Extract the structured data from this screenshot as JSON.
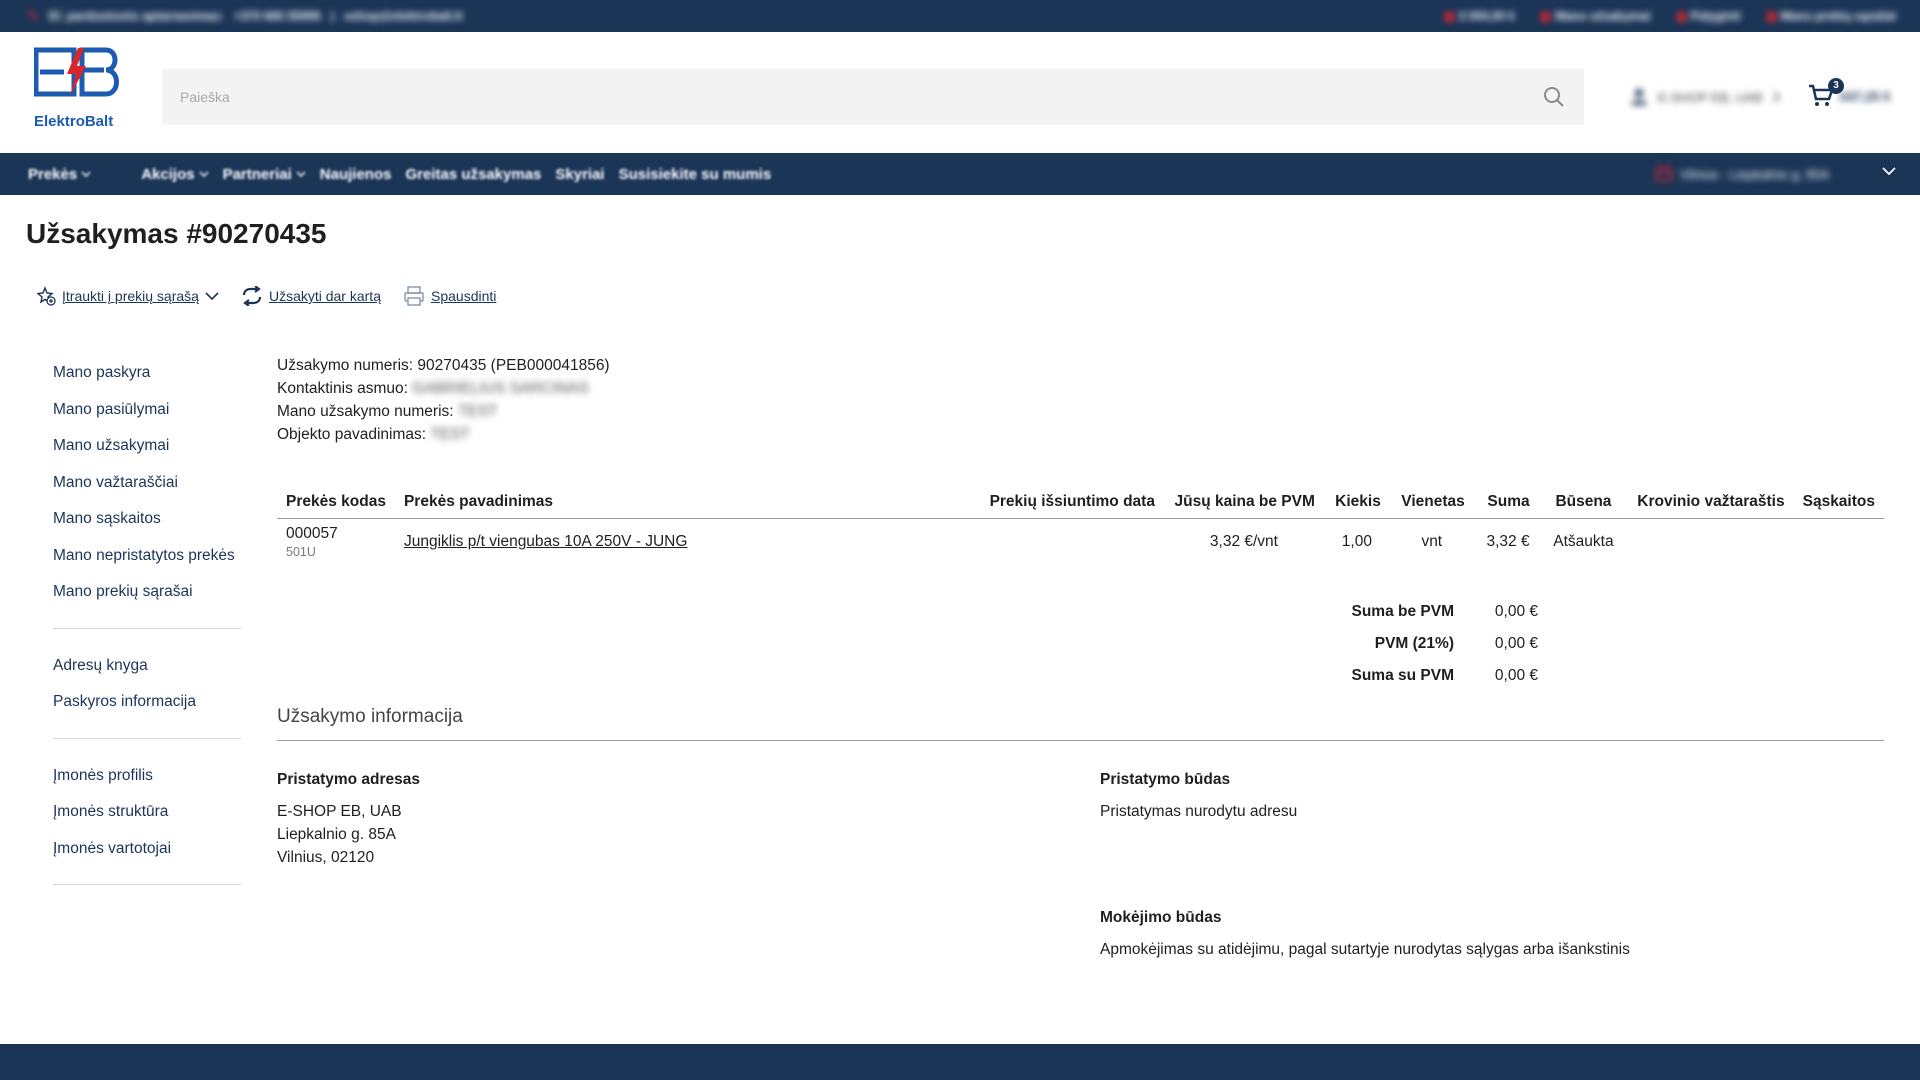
{
  "topbar": {
    "left_label": "El. parduotuvės aptarnavimas:",
    "phone": "+370 665 55995",
    "divider": "|",
    "email": "eshop@elektrobalt.lt",
    "right_items": [
      "3 000,00 €",
      "Mano užsakymai",
      "Palyginti",
      "Mano prekių sąrašai"
    ]
  },
  "header": {
    "logo_text": "ElektroBalt",
    "search_placeholder": "Paieška",
    "account_name": "E-SHOP EB, UAB",
    "cart_count": "3",
    "cart_total": "647,25 €"
  },
  "nav": {
    "items": [
      {
        "label": "Prekės",
        "dropdown": true
      },
      {
        "label": "Akcijos",
        "dropdown": true
      },
      {
        "label": "Partneriai",
        "dropdown": true
      },
      {
        "label": "Naujienos",
        "dropdown": false
      },
      {
        "label": "Greitas užsakymas",
        "dropdown": false
      },
      {
        "label": "Skyriai",
        "dropdown": false
      },
      {
        "label": "Susisiekite su mumis",
        "dropdown": false
      }
    ],
    "store": "Vilnius - Liepkalnio g. 85A"
  },
  "page": {
    "title": "Užsakymas #90270435",
    "actions": {
      "add_to_list": "Įtraukti į prekių sąrašą",
      "reorder": "Užsakyti dar kartą",
      "print": "Spausdinti"
    }
  },
  "sidebar": {
    "group1": [
      "Mano paskyra",
      "Mano pasiūlymai",
      "Mano užsakymai",
      "Mano važtaraščiai",
      "Mano sąskaitos",
      "Mano nepristatytos prekės",
      "Mano prekių sąrašai"
    ],
    "group2": [
      "Adresų knyga",
      "Paskyros informacija"
    ],
    "group3": [
      "Įmonės profilis",
      "Įmonės struktūra",
      "Įmonės vartotojai"
    ]
  },
  "order_info": {
    "number_label": "Užsakymo numeris:",
    "number_value": "90270435 (PEB000041856)",
    "contact_label": "Kontaktinis asmuo:",
    "contact_value": "GABRIELIUS SARCINAS",
    "my_number_label": "Mano užsakymo numeris:",
    "my_number_value": "TEST",
    "object_label": "Objekto pavadinimas:",
    "object_value": "TEST"
  },
  "table": {
    "headers": {
      "code": "Prekės kodas",
      "name": "Prekės pavadinimas",
      "ship_date": "Prekių išsiuntimo data",
      "price": "Jūsų kaina be PVM",
      "qty": "Kiekis",
      "unit": "Vienetas",
      "sum": "Suma",
      "status": "Būsena",
      "waybill": "Krovinio važtaraštis",
      "invoices": "Sąskaitos"
    },
    "rows": [
      {
        "code": "000057",
        "code_sub": "501U",
        "name": "Jungiklis p/t viengubas 10A 250V - JUNG",
        "ship_date": "",
        "price": "3,32 €/vnt",
        "qty": "1,00",
        "unit": "vnt",
        "sum": "3,32 €",
        "status": "Atšaukta",
        "waybill": "",
        "invoices": ""
      }
    ]
  },
  "totals": {
    "net_label": "Suma be PVM",
    "net_value": "0,00 €",
    "vat_label": "PVM (21%)",
    "vat_value": "0,00 €",
    "gross_label": "Suma su PVM",
    "gross_value": "0,00 €"
  },
  "order_details": {
    "section_title": "Užsakymo informacija",
    "delivery_address_title": "Pristatymo adresas",
    "address_lines": [
      "E-SHOP EB, UAB",
      "Liepkalnio g. 85A",
      "Vilnius, 02120"
    ],
    "delivery_method_title": "Pristatymo būdas",
    "delivery_method": "Pristatymas nurodytu adresu",
    "payment_title": "Mokėjimo būdas",
    "payment_method": "Apmokėjimas su atidėjimu, pagal sutartyje nurodytas sąlygas arba išankstinis"
  },
  "colors": {
    "brand_navy": "#1b3557",
    "accent_red": "#d9262b"
  }
}
